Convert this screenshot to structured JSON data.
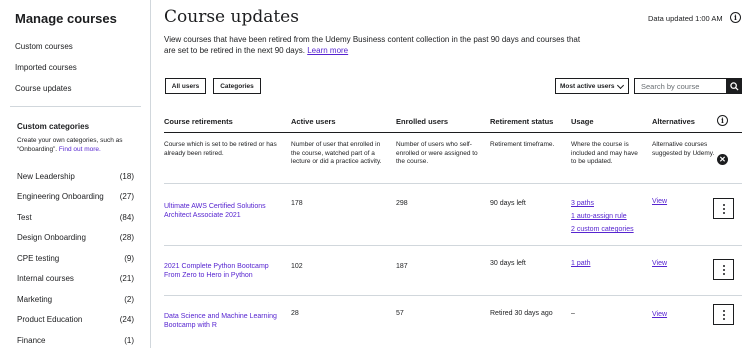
{
  "sidebar": {
    "title": "Manage courses",
    "links": [
      "Custom courses",
      "Imported courses",
      "Course updates"
    ],
    "categories_title": "Custom categories",
    "categories_desc": "Create your own categories, such as “Onboarding”.",
    "find_out_more": "Find out more.",
    "categories": [
      {
        "label": "New Leadership",
        "count": "(18)"
      },
      {
        "label": "Engineering Onboarding",
        "count": "(27)"
      },
      {
        "label": "Test",
        "count": "(84)"
      },
      {
        "label": "Design Onboarding",
        "count": "(28)"
      },
      {
        "label": "CPE testing",
        "count": "(9)"
      },
      {
        "label": "Internal courses",
        "count": "(21)"
      },
      {
        "label": "Marketing",
        "count": "(2)"
      },
      {
        "label": "Product Education",
        "count": "(24)"
      },
      {
        "label": "Finance",
        "count": "(1)"
      }
    ]
  },
  "header": {
    "title": "Course updates",
    "updated": "Data updated 1:00 AM",
    "info_icon": "info-icon",
    "description": "View courses that have been retired from the Udemy Business content collection in the past 90 days and courses that are set to be retired in the next 90 days.",
    "learn_more": "Learn more"
  },
  "filters": {
    "all_users": "All users",
    "categories": "Categories",
    "sort_value": "Most active users",
    "search_placeholder": "Search by course"
  },
  "table": {
    "headers": [
      "Course retirements",
      "Active users",
      "Enrolled users",
      "Retirement status",
      "Usage",
      "Alternatives"
    ],
    "descriptions": [
      "Course which is set to be retired or has already been retired.",
      "Number of user that enrolled in the course, watched part of a lecture or did a practice activity.",
      "Number of users who self-enrolled or were assigned to the course.",
      "Retirement timeframe.",
      "Where the course is included and may have to be updated.",
      "Alternative courses suggested by Udemy."
    ],
    "rows": [
      {
        "course": "Ultimate AWS Certified Solutions Architect Associate 2021",
        "active": "178",
        "enrolled": "298",
        "status": "90 days left",
        "usage": [
          "3 paths",
          "1 auto-assign rule",
          "2 custom categories"
        ],
        "alternatives": "View"
      },
      {
        "course": "2021 Complete Python Bootcamp From Zero to Hero in Python",
        "active": "102",
        "enrolled": "187",
        "status": "30 days left",
        "usage": [
          "1 path"
        ],
        "alternatives": "View"
      },
      {
        "course": "Data Science and Machine Learning Bootcamp with R",
        "active": "28",
        "enrolled": "57",
        "status": "Retired 30 days ago",
        "usage": [
          "–"
        ],
        "alternatives": "View"
      }
    ]
  }
}
